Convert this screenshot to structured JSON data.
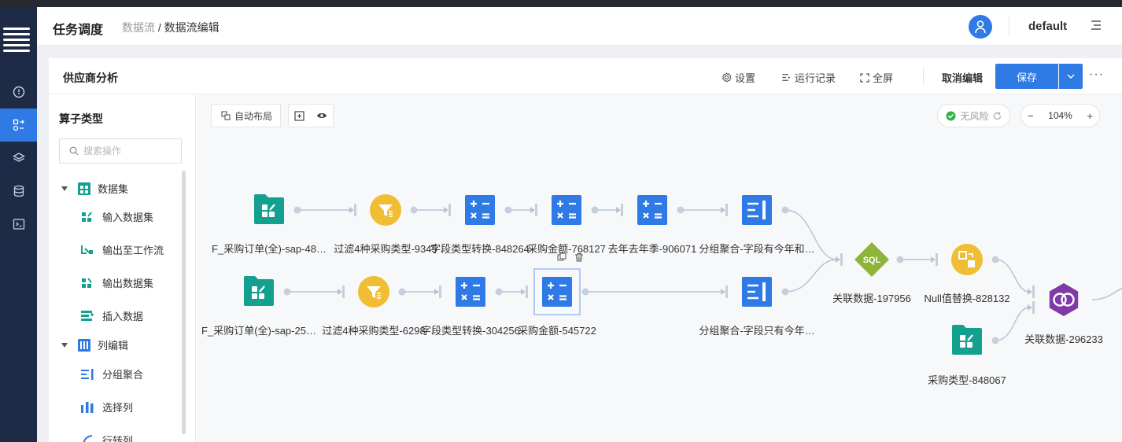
{
  "header": {
    "app_title": "任务调度",
    "breadcrumb_parent": "数据流",
    "breadcrumb_sep": " / ",
    "breadcrumb_current": "数据流编辑",
    "user_name": "default"
  },
  "toolbar": {
    "flow_name": "供应商分析",
    "settings_label": "设置",
    "run_records_label": "运行记录",
    "fullscreen_label": "全屏",
    "cancel_edit_label": "取消编辑",
    "save_label": "保存",
    "more_label": "···"
  },
  "sidebar": {
    "title": "算子类型",
    "search_placeholder": "搜索操作",
    "groups": [
      {
        "label": "数据集",
        "items": [
          {
            "label": "输入数据集"
          },
          {
            "label": "输出至工作流"
          },
          {
            "label": "输出数据集"
          },
          {
            "label": "插入数据"
          }
        ]
      },
      {
        "label": "列编辑",
        "items": [
          {
            "label": "分组聚合"
          },
          {
            "label": "选择列"
          },
          {
            "label": "行转列"
          }
        ]
      }
    ]
  },
  "canvas": {
    "auto_layout_label": "自动布局",
    "risk_label": "无风险",
    "zoom_level": "104%",
    "zoom_minus": "−",
    "zoom_plus": "+",
    "nodes": [
      {
        "label": "F_采购订单(全)-sap-48…",
        "icon": "dataset-icon"
      },
      {
        "label": "过滤4种采购类型-9345",
        "icon": "filter-icon"
      },
      {
        "label": "字段类型转换-848264",
        "icon": "calc-icon"
      },
      {
        "label": "采购金额-768127",
        "icon": "calc-icon"
      },
      {
        "label": "去年去年季-906071",
        "icon": "calc-icon"
      },
      {
        "label": "分组聚合-字段有今年和…",
        "icon": "group-icon"
      },
      {
        "label": "F_采购订单(全)-sap-25…",
        "icon": "dataset-icon"
      },
      {
        "label": "过滤4种采购类型-6298",
        "icon": "filter-icon"
      },
      {
        "label": "字段类型转换-304256",
        "icon": "calc-icon"
      },
      {
        "label": "采购金额-545722",
        "icon": "calc-icon"
      },
      {
        "label": "分组聚合-字段只有今年…",
        "icon": "group-icon"
      },
      {
        "label": "关联数据-197956",
        "icon": "sql-icon"
      },
      {
        "label": "Null值替换-828132",
        "icon": "replace-icon"
      },
      {
        "label": "关联数据-296233",
        "icon": "join-icon"
      },
      {
        "label": "采购类型-848067",
        "icon": "dataset-icon"
      }
    ]
  },
  "colors": {
    "accent": "#2f7ae5",
    "teal": "#14a08f",
    "yellow": "#f0bd33",
    "green": "#8fb43a",
    "purple": "#7f3aa6",
    "rail": "#1e2b46"
  }
}
